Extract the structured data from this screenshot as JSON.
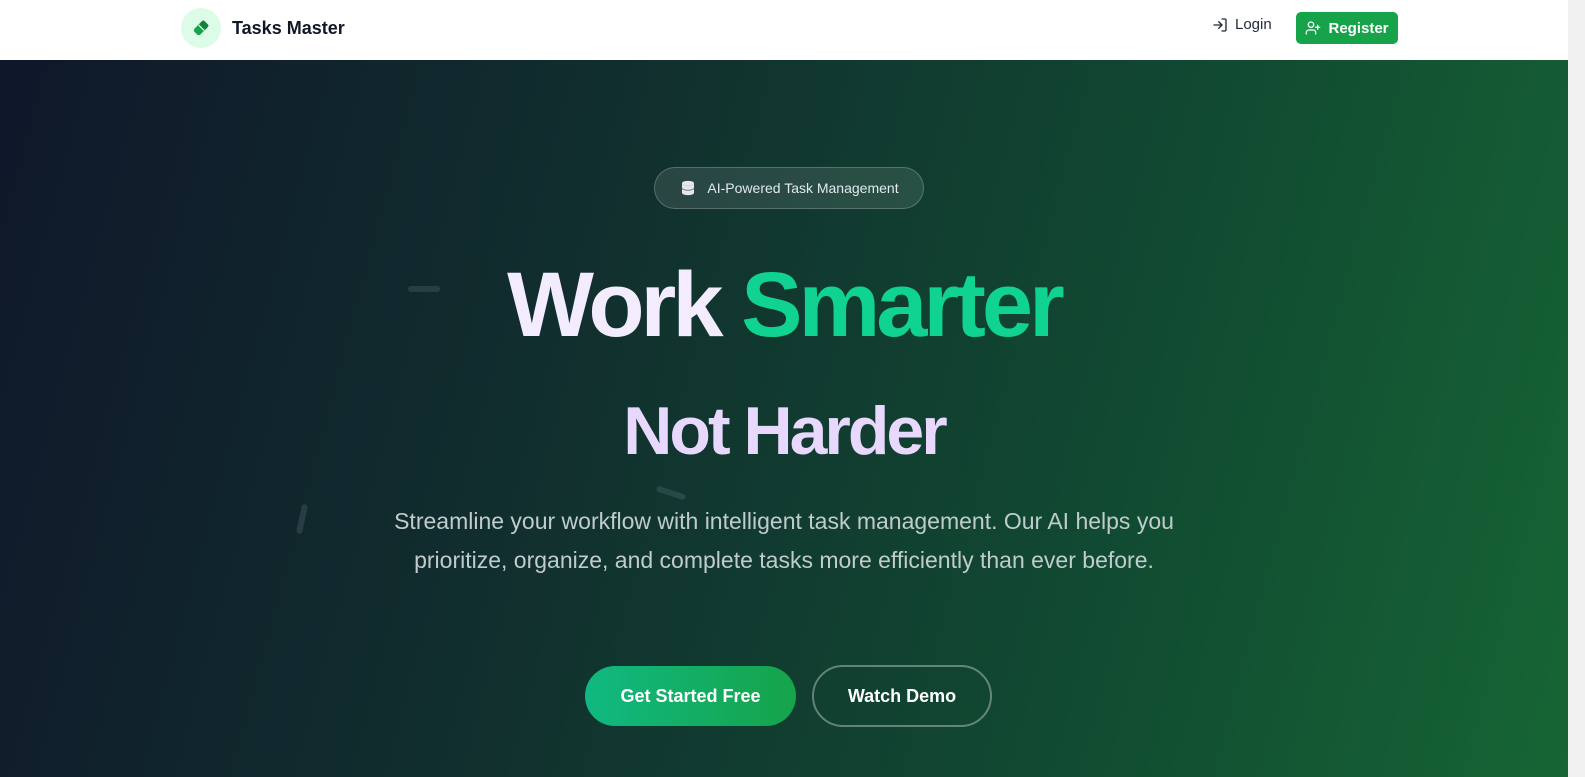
{
  "header": {
    "brand_name": "Tasks Master",
    "login_label": "Login",
    "register_label": "Register"
  },
  "hero": {
    "badge": "AI-Powered Task Management",
    "headline_word_1": "Work",
    "headline_word_2": "Smarter",
    "headline_line_2": "Not Harder",
    "subtitle": "Streamline your workflow with intelligent task management. Our AI helps you prioritize, organize, and complete tasks more efficiently than ever before.",
    "cta_primary": "Get Started Free",
    "cta_secondary": "Watch Demo"
  },
  "icons": {
    "logo": "eraser-icon",
    "login": "log-in-icon",
    "register": "user-plus-icon",
    "badge": "database-icon"
  },
  "colors": {
    "brand_green": "#16a34a",
    "accent_green": "#10d391",
    "logo_bg": "#dcfce7",
    "hero_gradient_start": "#0f172a",
    "hero_gradient_end": "#166534",
    "headline_light": "#f3ecff"
  }
}
